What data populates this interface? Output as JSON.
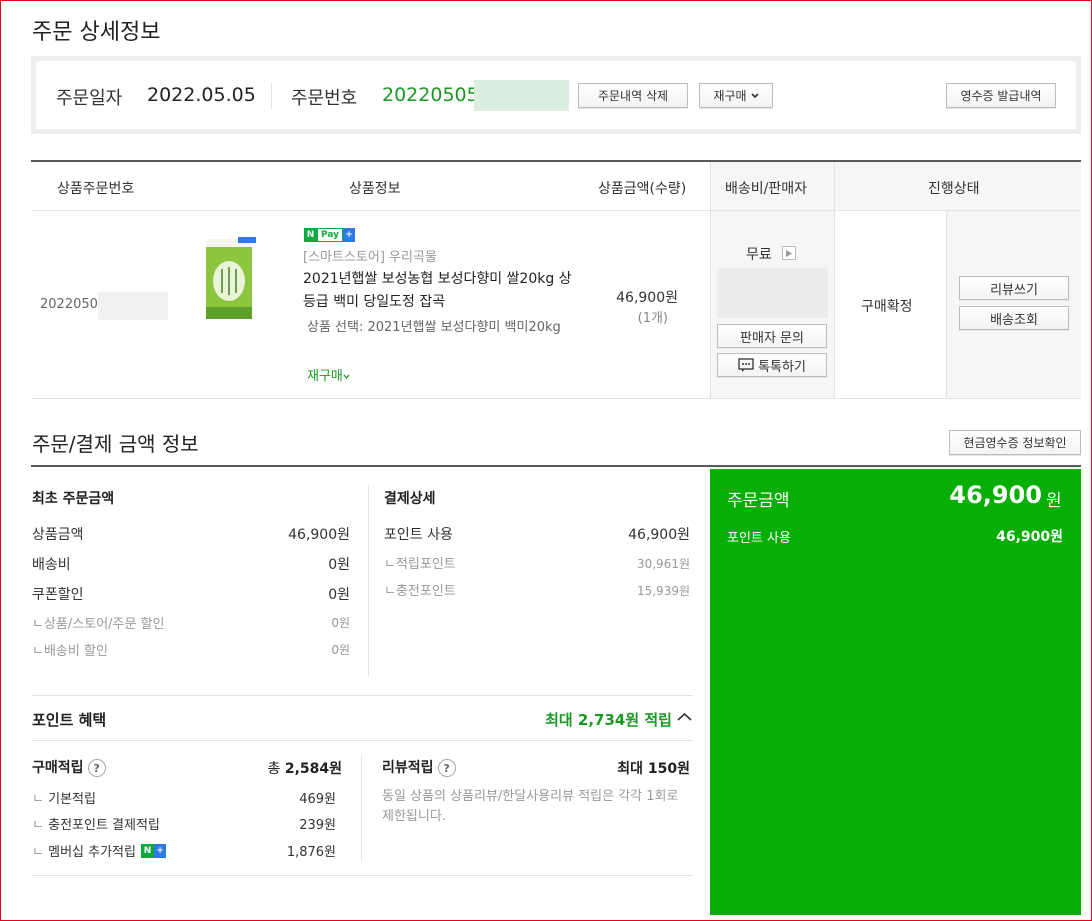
{
  "page_title": "주문 상세정보",
  "order": {
    "date_label": "주문일자",
    "date_value": "2022.05.05",
    "number_label": "주문번호",
    "number_value": "20220505",
    "delete_button": "주문내역 삭제",
    "reorder_button": "재구매",
    "receipt_button": "영수증 발급내역"
  },
  "table": {
    "headers": [
      "상품주문번호",
      "상품정보",
      "상품금액(수량)",
      "배송비/판매자",
      "진행상태"
    ],
    "row": {
      "product_order_no": "20220505",
      "store": "[스마트스토어] 우리곡물",
      "npay_n": "N",
      "npay_pay": "Pay",
      "npay_plus": "+",
      "product_name": "2021년햅쌀 보성농협 보성다향미 쌀20kg 상등급 백미 당일도정 잡곡",
      "option": "상품 선택: 2021년햅쌀 보성다향미 백미20kg",
      "reorder_link": "재구매",
      "price": "46,900원",
      "qty": "(1개)",
      "shipping": "무료",
      "seller_inquiry_button": "판매자 문의",
      "talk_button": "톡톡하기",
      "status": "구매확정",
      "review_button": "리뷰쓰기",
      "tracking_button": "배송조회"
    }
  },
  "payment": {
    "section_title": "주문/결제 금액 정보",
    "cash_receipt_button": "현금영수증 정보확인",
    "initial": {
      "title": "최초 주문금액",
      "rows": [
        {
          "label": "상품금액",
          "value": "46,900원"
        },
        {
          "label": "배송비",
          "value": "0원"
        },
        {
          "label": "쿠폰할인",
          "value": "0원"
        }
      ],
      "subrows": [
        {
          "label": "상품/스토어/주문 할인",
          "value": "0원"
        },
        {
          "label": "배송비 할인",
          "value": "0원"
        }
      ]
    },
    "detail": {
      "title": "결제상세",
      "rows": [
        {
          "label": "포인트 사용",
          "value": "46,900원"
        }
      ],
      "subrows": [
        {
          "label": "적립포인트",
          "value": "30,961원"
        },
        {
          "label": "충전포인트",
          "value": "15,939원"
        }
      ]
    },
    "summary": {
      "label": "주문금액",
      "amount": "46,900",
      "unit": "원",
      "point_label": "포인트 사용",
      "point_value": "46,900원"
    }
  },
  "points": {
    "title": "포인트 혜택",
    "max_label": "최대 2,734원 적립",
    "purchase": {
      "title": "구매적립",
      "total_prefix": "총",
      "total": "2,584원",
      "rows": [
        {
          "label": "기본적립",
          "value": "469원"
        },
        {
          "label": "충전포인트 결제적립",
          "value": "239원"
        },
        {
          "label": "멤버십 추가적립",
          "value": "1,876원"
        }
      ]
    },
    "review": {
      "title": "리뷰적립",
      "max_prefix": "최대",
      "max_value": "150원",
      "note": "동일 상품의 상품리뷰/한달사용리뷰 적립은 각각 1회로 제한됩니다."
    }
  },
  "colors": {
    "accent_green": "#06ae06",
    "order_number_green": "#1a9a23",
    "frame_red": "#e8001c"
  }
}
